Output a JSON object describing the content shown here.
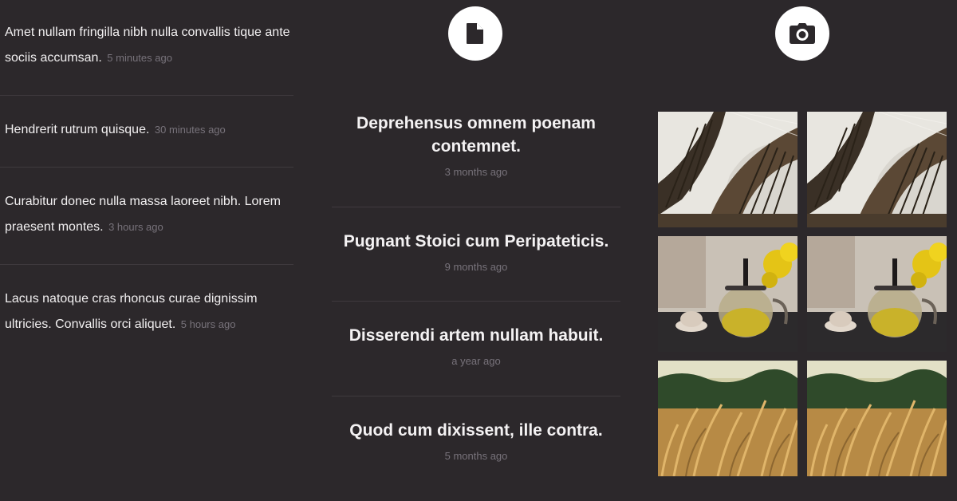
{
  "comments": [
    {
      "text": "Amet nullam fringilla nibh nulla convallis tique ante sociis accumsan.",
      "time": "5 minutes ago"
    },
    {
      "text": "Hendrerit rutrum quisque.",
      "time": "30 minutes ago"
    },
    {
      "text": "Curabitur donec nulla massa laoreet nibh. Lorem praesent montes.",
      "time": "3 hours ago"
    },
    {
      "text": "Lacus natoque cras rhoncus curae dignissim ultricies. Convallis orci aliquet.",
      "time": "5 hours ago"
    }
  ],
  "posts_section": {
    "icon": "document-icon"
  },
  "posts": [
    {
      "title": "Deprehensus omnem poenam contemnet.",
      "time": "3 months ago"
    },
    {
      "title": "Pugnant Stoici cum Peripateticis.",
      "time": "9 months ago"
    },
    {
      "title": "Disserendi artem nullam habuit.",
      "time": "a year ago"
    },
    {
      "title": "Quod cum dixissent, ille contra.",
      "time": "5 months ago"
    }
  ],
  "photos_section": {
    "icon": "camera-icon"
  },
  "photos": [
    {
      "subject": "library-interior"
    },
    {
      "subject": "library-interior"
    },
    {
      "subject": "teapot"
    },
    {
      "subject": "teapot"
    },
    {
      "subject": "wheat-field"
    },
    {
      "subject": "wheat-field"
    }
  ],
  "colors": {
    "background": "#2c282b",
    "text": "#f2f0f1",
    "muted": "#77727a",
    "divider": "#3f3a3e",
    "icon_circle": "#ffffff"
  }
}
